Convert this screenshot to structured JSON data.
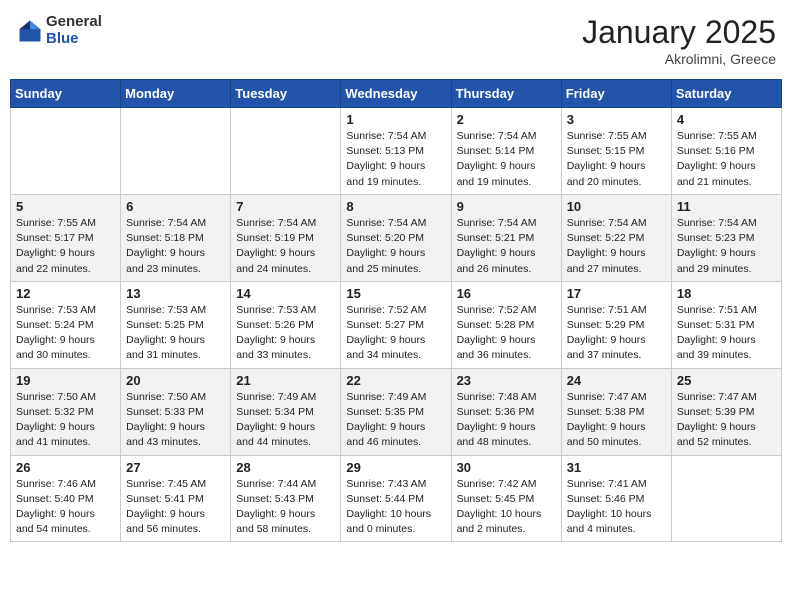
{
  "header": {
    "logo_general": "General",
    "logo_blue": "Blue",
    "month": "January 2025",
    "location": "Akrolimni, Greece"
  },
  "weekdays": [
    "Sunday",
    "Monday",
    "Tuesday",
    "Wednesday",
    "Thursday",
    "Friday",
    "Saturday"
  ],
  "weeks": [
    [
      {
        "day": "",
        "info": ""
      },
      {
        "day": "",
        "info": ""
      },
      {
        "day": "",
        "info": ""
      },
      {
        "day": "1",
        "info": "Sunrise: 7:54 AM\nSunset: 5:13 PM\nDaylight: 9 hours\nand 19 minutes."
      },
      {
        "day": "2",
        "info": "Sunrise: 7:54 AM\nSunset: 5:14 PM\nDaylight: 9 hours\nand 19 minutes."
      },
      {
        "day": "3",
        "info": "Sunrise: 7:55 AM\nSunset: 5:15 PM\nDaylight: 9 hours\nand 20 minutes."
      },
      {
        "day": "4",
        "info": "Sunrise: 7:55 AM\nSunset: 5:16 PM\nDaylight: 9 hours\nand 21 minutes."
      }
    ],
    [
      {
        "day": "5",
        "info": "Sunrise: 7:55 AM\nSunset: 5:17 PM\nDaylight: 9 hours\nand 22 minutes."
      },
      {
        "day": "6",
        "info": "Sunrise: 7:54 AM\nSunset: 5:18 PM\nDaylight: 9 hours\nand 23 minutes."
      },
      {
        "day": "7",
        "info": "Sunrise: 7:54 AM\nSunset: 5:19 PM\nDaylight: 9 hours\nand 24 minutes."
      },
      {
        "day": "8",
        "info": "Sunrise: 7:54 AM\nSunset: 5:20 PM\nDaylight: 9 hours\nand 25 minutes."
      },
      {
        "day": "9",
        "info": "Sunrise: 7:54 AM\nSunset: 5:21 PM\nDaylight: 9 hours\nand 26 minutes."
      },
      {
        "day": "10",
        "info": "Sunrise: 7:54 AM\nSunset: 5:22 PM\nDaylight: 9 hours\nand 27 minutes."
      },
      {
        "day": "11",
        "info": "Sunrise: 7:54 AM\nSunset: 5:23 PM\nDaylight: 9 hours\nand 29 minutes."
      }
    ],
    [
      {
        "day": "12",
        "info": "Sunrise: 7:53 AM\nSunset: 5:24 PM\nDaylight: 9 hours\nand 30 minutes."
      },
      {
        "day": "13",
        "info": "Sunrise: 7:53 AM\nSunset: 5:25 PM\nDaylight: 9 hours\nand 31 minutes."
      },
      {
        "day": "14",
        "info": "Sunrise: 7:53 AM\nSunset: 5:26 PM\nDaylight: 9 hours\nand 33 minutes."
      },
      {
        "day": "15",
        "info": "Sunrise: 7:52 AM\nSunset: 5:27 PM\nDaylight: 9 hours\nand 34 minutes."
      },
      {
        "day": "16",
        "info": "Sunrise: 7:52 AM\nSunset: 5:28 PM\nDaylight: 9 hours\nand 36 minutes."
      },
      {
        "day": "17",
        "info": "Sunrise: 7:51 AM\nSunset: 5:29 PM\nDaylight: 9 hours\nand 37 minutes."
      },
      {
        "day": "18",
        "info": "Sunrise: 7:51 AM\nSunset: 5:31 PM\nDaylight: 9 hours\nand 39 minutes."
      }
    ],
    [
      {
        "day": "19",
        "info": "Sunrise: 7:50 AM\nSunset: 5:32 PM\nDaylight: 9 hours\nand 41 minutes."
      },
      {
        "day": "20",
        "info": "Sunrise: 7:50 AM\nSunset: 5:33 PM\nDaylight: 9 hours\nand 43 minutes."
      },
      {
        "day": "21",
        "info": "Sunrise: 7:49 AM\nSunset: 5:34 PM\nDaylight: 9 hours\nand 44 minutes."
      },
      {
        "day": "22",
        "info": "Sunrise: 7:49 AM\nSunset: 5:35 PM\nDaylight: 9 hours\nand 46 minutes."
      },
      {
        "day": "23",
        "info": "Sunrise: 7:48 AM\nSunset: 5:36 PM\nDaylight: 9 hours\nand 48 minutes."
      },
      {
        "day": "24",
        "info": "Sunrise: 7:47 AM\nSunset: 5:38 PM\nDaylight: 9 hours\nand 50 minutes."
      },
      {
        "day": "25",
        "info": "Sunrise: 7:47 AM\nSunset: 5:39 PM\nDaylight: 9 hours\nand 52 minutes."
      }
    ],
    [
      {
        "day": "26",
        "info": "Sunrise: 7:46 AM\nSunset: 5:40 PM\nDaylight: 9 hours\nand 54 minutes."
      },
      {
        "day": "27",
        "info": "Sunrise: 7:45 AM\nSunset: 5:41 PM\nDaylight: 9 hours\nand 56 minutes."
      },
      {
        "day": "28",
        "info": "Sunrise: 7:44 AM\nSunset: 5:43 PM\nDaylight: 9 hours\nand 58 minutes."
      },
      {
        "day": "29",
        "info": "Sunrise: 7:43 AM\nSunset: 5:44 PM\nDaylight: 10 hours\nand 0 minutes."
      },
      {
        "day": "30",
        "info": "Sunrise: 7:42 AM\nSunset: 5:45 PM\nDaylight: 10 hours\nand 2 minutes."
      },
      {
        "day": "31",
        "info": "Sunrise: 7:41 AM\nSunset: 5:46 PM\nDaylight: 10 hours\nand 4 minutes."
      },
      {
        "day": "",
        "info": ""
      }
    ]
  ]
}
